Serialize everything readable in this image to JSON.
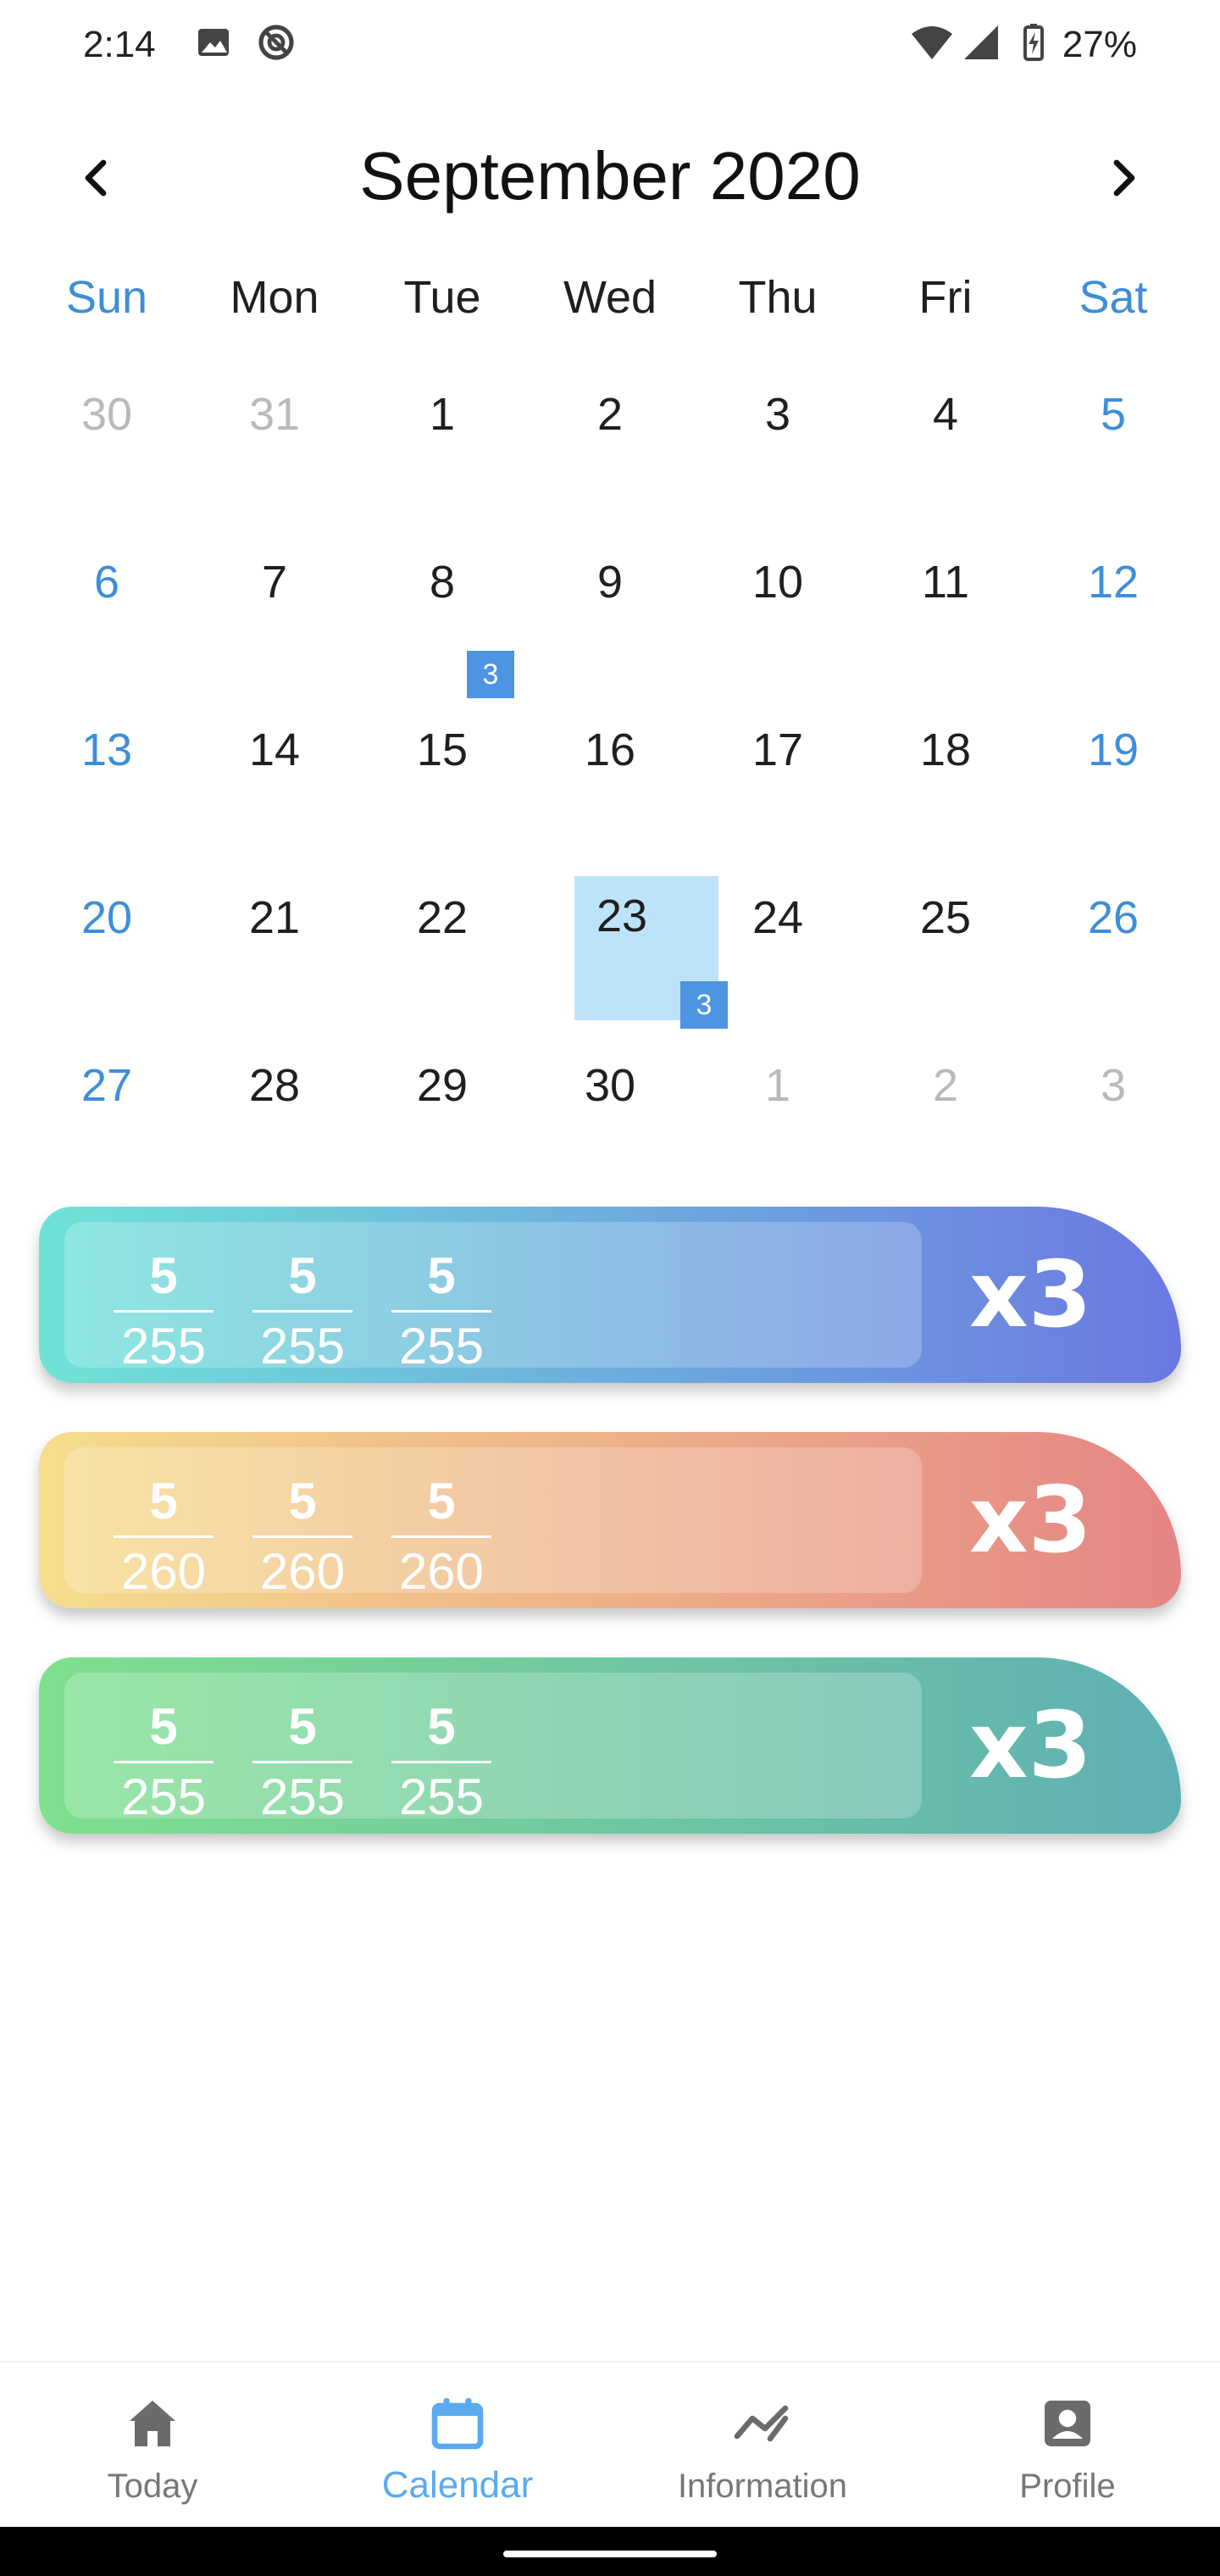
{
  "status_bar": {
    "time": "2:14",
    "battery": "27%",
    "icons": [
      "image-icon",
      "do-not-disturb-icon",
      "wifi-icon",
      "cellular-signal-icon",
      "battery-charging-icon"
    ]
  },
  "calendar": {
    "month_title": "September 2020",
    "prev_icon": "chevron-left-icon",
    "next_icon": "chevron-right-icon",
    "weekdays": [
      "Sun",
      "Mon",
      "Tue",
      "Wed",
      "Thu",
      "Fri",
      "Sat"
    ],
    "weeks": [
      [
        {
          "day": "30",
          "outside": true
        },
        {
          "day": "31",
          "outside": true
        },
        {
          "day": "1"
        },
        {
          "day": "2"
        },
        {
          "day": "3"
        },
        {
          "day": "4"
        },
        {
          "day": "5"
        }
      ],
      [
        {
          "day": "6"
        },
        {
          "day": "7"
        },
        {
          "day": "8",
          "badge": "3"
        },
        {
          "day": "9"
        },
        {
          "day": "10"
        },
        {
          "day": "11"
        },
        {
          "day": "12"
        }
      ],
      [
        {
          "day": "13"
        },
        {
          "day": "14"
        },
        {
          "day": "15"
        },
        {
          "day": "16"
        },
        {
          "day": "17"
        },
        {
          "day": "18"
        },
        {
          "day": "19"
        }
      ],
      [
        {
          "day": "20"
        },
        {
          "day": "21"
        },
        {
          "day": "22"
        },
        {
          "day": "23",
          "selected": true,
          "badge": "3"
        },
        {
          "day": "24"
        },
        {
          "day": "25"
        },
        {
          "day": "26"
        }
      ],
      [
        {
          "day": "27"
        },
        {
          "day": "28"
        },
        {
          "day": "29"
        },
        {
          "day": "30"
        },
        {
          "day": "1",
          "outside": true
        },
        {
          "day": "2",
          "outside": true
        },
        {
          "day": "3",
          "outside": true
        }
      ]
    ],
    "colors": {
      "weekend": "#3d8ed8",
      "outside": "#b9b9b9",
      "selected_bg": "#bde3fa",
      "badge": "#4d94e2"
    }
  },
  "cards": [
    {
      "fractions": [
        {
          "num": "5",
          "den": "255"
        },
        {
          "num": "5",
          "den": "255"
        },
        {
          "num": "5",
          "den": "255"
        }
      ],
      "multiplier": "x3",
      "gradient": [
        "#6fe3d8",
        "#6b78e2"
      ]
    },
    {
      "fractions": [
        {
          "num": "5",
          "den": "260"
        },
        {
          "num": "5",
          "den": "260"
        },
        {
          "num": "5",
          "den": "260"
        }
      ],
      "multiplier": "x3",
      "gradient": [
        "#f6dd8c",
        "#e58585"
      ]
    },
    {
      "fractions": [
        {
          "num": "5",
          "den": "255"
        },
        {
          "num": "5",
          "den": "255"
        },
        {
          "num": "5",
          "den": "255"
        }
      ],
      "multiplier": "x3",
      "gradient": [
        "#7fe08e",
        "#5fb0b4"
      ]
    }
  ],
  "bottom_nav": {
    "items": [
      {
        "label": "Today",
        "icon": "home-icon",
        "active": false
      },
      {
        "label": "Calendar",
        "icon": "calendar-icon",
        "active": true
      },
      {
        "label": "Information",
        "icon": "trend-icon",
        "active": false
      },
      {
        "label": "Profile",
        "icon": "profile-icon",
        "active": false
      }
    ],
    "active_color": "#5aaaf0",
    "inactive_color": "#777777"
  }
}
